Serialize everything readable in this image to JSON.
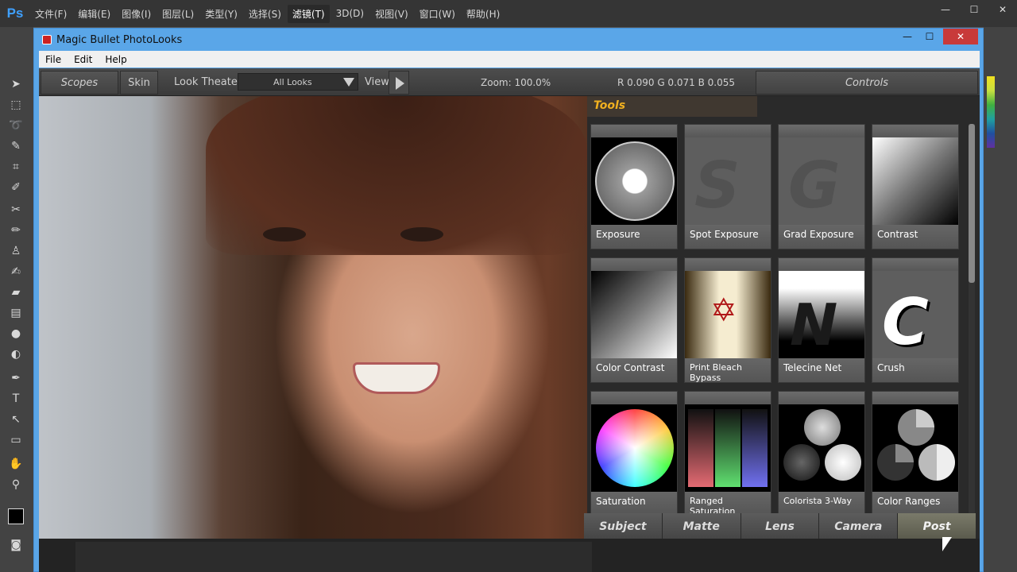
{
  "ps": {
    "logo": "Ps",
    "menus": [
      "文件(F)",
      "编辑(E)",
      "图像(I)",
      "图层(L)",
      "类型(Y)",
      "选择(S)",
      "滤镜(T)",
      "3D(D)",
      "视图(V)",
      "窗口(W)",
      "帮助(H)"
    ],
    "active_menu": "滤镜(T)",
    "window_buttons": [
      "—",
      "☐",
      "✕"
    ]
  },
  "plugin": {
    "title": "Magic Bullet PhotoLooks",
    "title_buttons": {
      "minimize": "—",
      "maximize": "☐",
      "close": "✕"
    },
    "menus": [
      "File",
      "Edit",
      "Help"
    ],
    "toolbar": {
      "scopes": "Scopes",
      "skin": "Skin",
      "look_theater": "Look Theater",
      "all_looks": "All Looks",
      "view": "View",
      "zoom": "Zoom:  100.0%",
      "rgb": "R 0.090   G 0.071   B 0.055",
      "controls": "Controls"
    },
    "tools_header": "Tools",
    "tools": [
      {
        "label": "Exposure",
        "icon": "aperture-icon",
        "ghost": ""
      },
      {
        "label": "Spot Exposure",
        "icon": "",
        "ghost": "S"
      },
      {
        "label": "Grad Exposure",
        "icon": "",
        "ghost": "G"
      },
      {
        "label": "Contrast",
        "icon": "gradient-icon",
        "ghost": ""
      },
      {
        "label": "Color Contrast",
        "icon": "gradient-icon",
        "ghost": ""
      },
      {
        "label": "Print Bleach Bypass",
        "icon": "bleach-icon",
        "ghost": ""
      },
      {
        "label": "Telecine Net",
        "icon": "telecine-icon",
        "ghost": ""
      },
      {
        "label": "Crush",
        "icon": "crush-icon",
        "ghost": ""
      },
      {
        "label": "Saturation",
        "icon": "color-wheel-icon",
        "ghost": ""
      },
      {
        "label": "Ranged Saturation",
        "icon": "rgb-bars-icon",
        "ghost": ""
      },
      {
        "label": "Colorista 3-Way",
        "icon": "three-way-icon",
        "ghost": ""
      },
      {
        "label": "Color Ranges",
        "icon": "color-ranges-icon",
        "ghost": ""
      }
    ],
    "categories": [
      "Subject",
      "Matte",
      "Lens",
      "Camera",
      "Post"
    ],
    "active_category": "Post"
  }
}
